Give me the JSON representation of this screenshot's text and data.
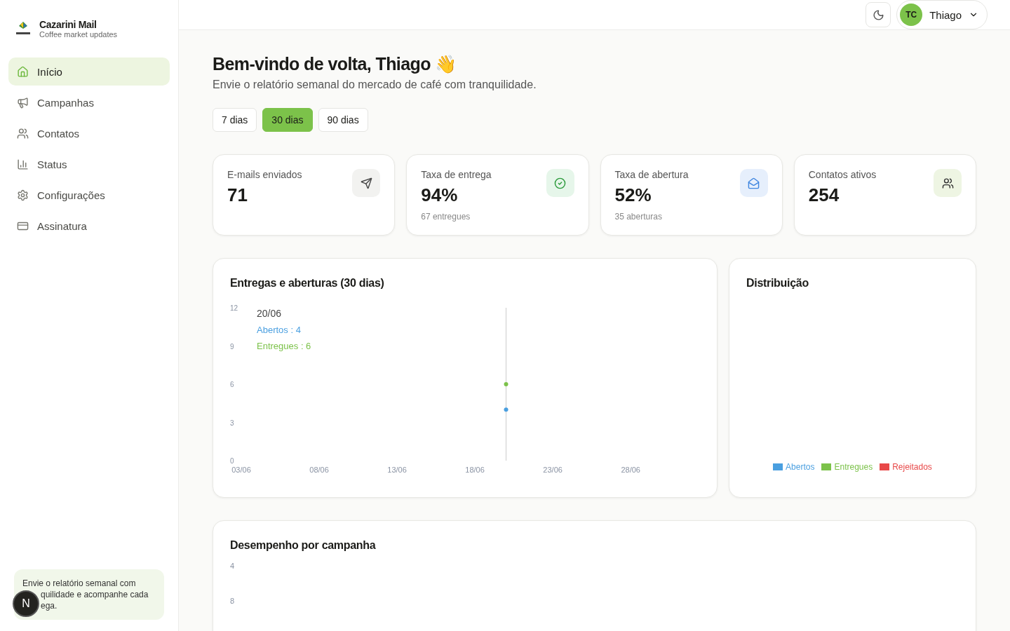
{
  "brand": {
    "name": "Cazarini Mail",
    "tagline": "Coffee market updates"
  },
  "sidebar": {
    "items": [
      {
        "label": "Início",
        "selected": true
      },
      {
        "label": "Campanhas",
        "selected": false
      },
      {
        "label": "Contatos",
        "selected": false
      },
      {
        "label": "Status",
        "selected": false
      },
      {
        "label": "Configurações",
        "selected": false
      },
      {
        "label": "Assinatura",
        "selected": false
      }
    ],
    "note_lines": [
      "Envie o relatório semanal com",
      "quilidade e acompanhe cada",
      "ega."
    ],
    "badge": "N"
  },
  "header": {
    "user_initials": "TC",
    "user_name": "Thiago"
  },
  "welcome": {
    "title": "Bem-vindo de volta, Thiago",
    "emoji": "👋",
    "subtitle": "Envie o relatório semanal do mercado de café com tranquilidade."
  },
  "ranges": [
    {
      "label": "7 dias",
      "selected": false
    },
    {
      "label": "30 dias",
      "selected": true
    },
    {
      "label": "90 dias",
      "selected": false
    }
  ],
  "stats": [
    {
      "label": "E-mails enviados",
      "value": "71",
      "color": "#f2f2f0"
    },
    {
      "label": "Taxa de entrega",
      "value": "94%",
      "note": "67 entregues",
      "color": "#e6f6ea"
    },
    {
      "label": "Taxa de abertura",
      "value": "52%",
      "note": "35 aberturas",
      "color": "#e6effc"
    },
    {
      "label": "Contatos ativos",
      "value": "254",
      "color": "#eef5e3"
    }
  ],
  "delivery_chart": {
    "title": "Entregas e aberturas (30 dias)",
    "chart_data": {
      "type": "line",
      "categories": [
        "03/06",
        null,
        null,
        null,
        null,
        "08/06",
        null,
        null,
        null,
        null,
        "13/06",
        null,
        null,
        null,
        null,
        "18/06",
        null,
        null,
        null,
        null,
        "23/06",
        null,
        null,
        null,
        null,
        "28/06",
        null,
        null,
        null,
        null
      ],
      "series": [
        {
          "name": "Abertos",
          "color": "#4a9fe0",
          "marker": true,
          "values": [
            null,
            null,
            null,
            null,
            null,
            null,
            null,
            null,
            null,
            null,
            null,
            null,
            null,
            null,
            null,
            null,
            null,
            4,
            null,
            null,
            null,
            null,
            null,
            null,
            null,
            null,
            null,
            null,
            null,
            null
          ]
        },
        {
          "name": "Entregues",
          "color": "#7cc24a",
          "marker": true,
          "values": [
            null,
            null,
            null,
            null,
            null,
            null,
            null,
            null,
            null,
            null,
            null,
            null,
            null,
            null,
            null,
            null,
            null,
            6,
            null,
            null,
            null,
            null,
            null,
            null,
            null,
            null,
            null,
            null,
            null,
            null
          ]
        }
      ],
      "ylim": [
        0,
        12
      ],
      "yticks": [
        0,
        3,
        6,
        9,
        12
      ]
    },
    "tooltip": {
      "title": "20/06",
      "values": [
        ": 4",
        ": 6"
      ]
    }
  },
  "distribution": {
    "title": "Distribuição",
    "legend": [
      {
        "label": "Abertos",
        "color": "#4a9fe0"
      },
      {
        "label": "Entregues",
        "color": "#7cc24a"
      },
      {
        "label": "Rejeitados",
        "color": "#e84848"
      }
    ]
  },
  "campaign_chart": {
    "title": "Desempenho por campanha",
    "axis_labels": [
      "4",
      "8"
    ]
  }
}
